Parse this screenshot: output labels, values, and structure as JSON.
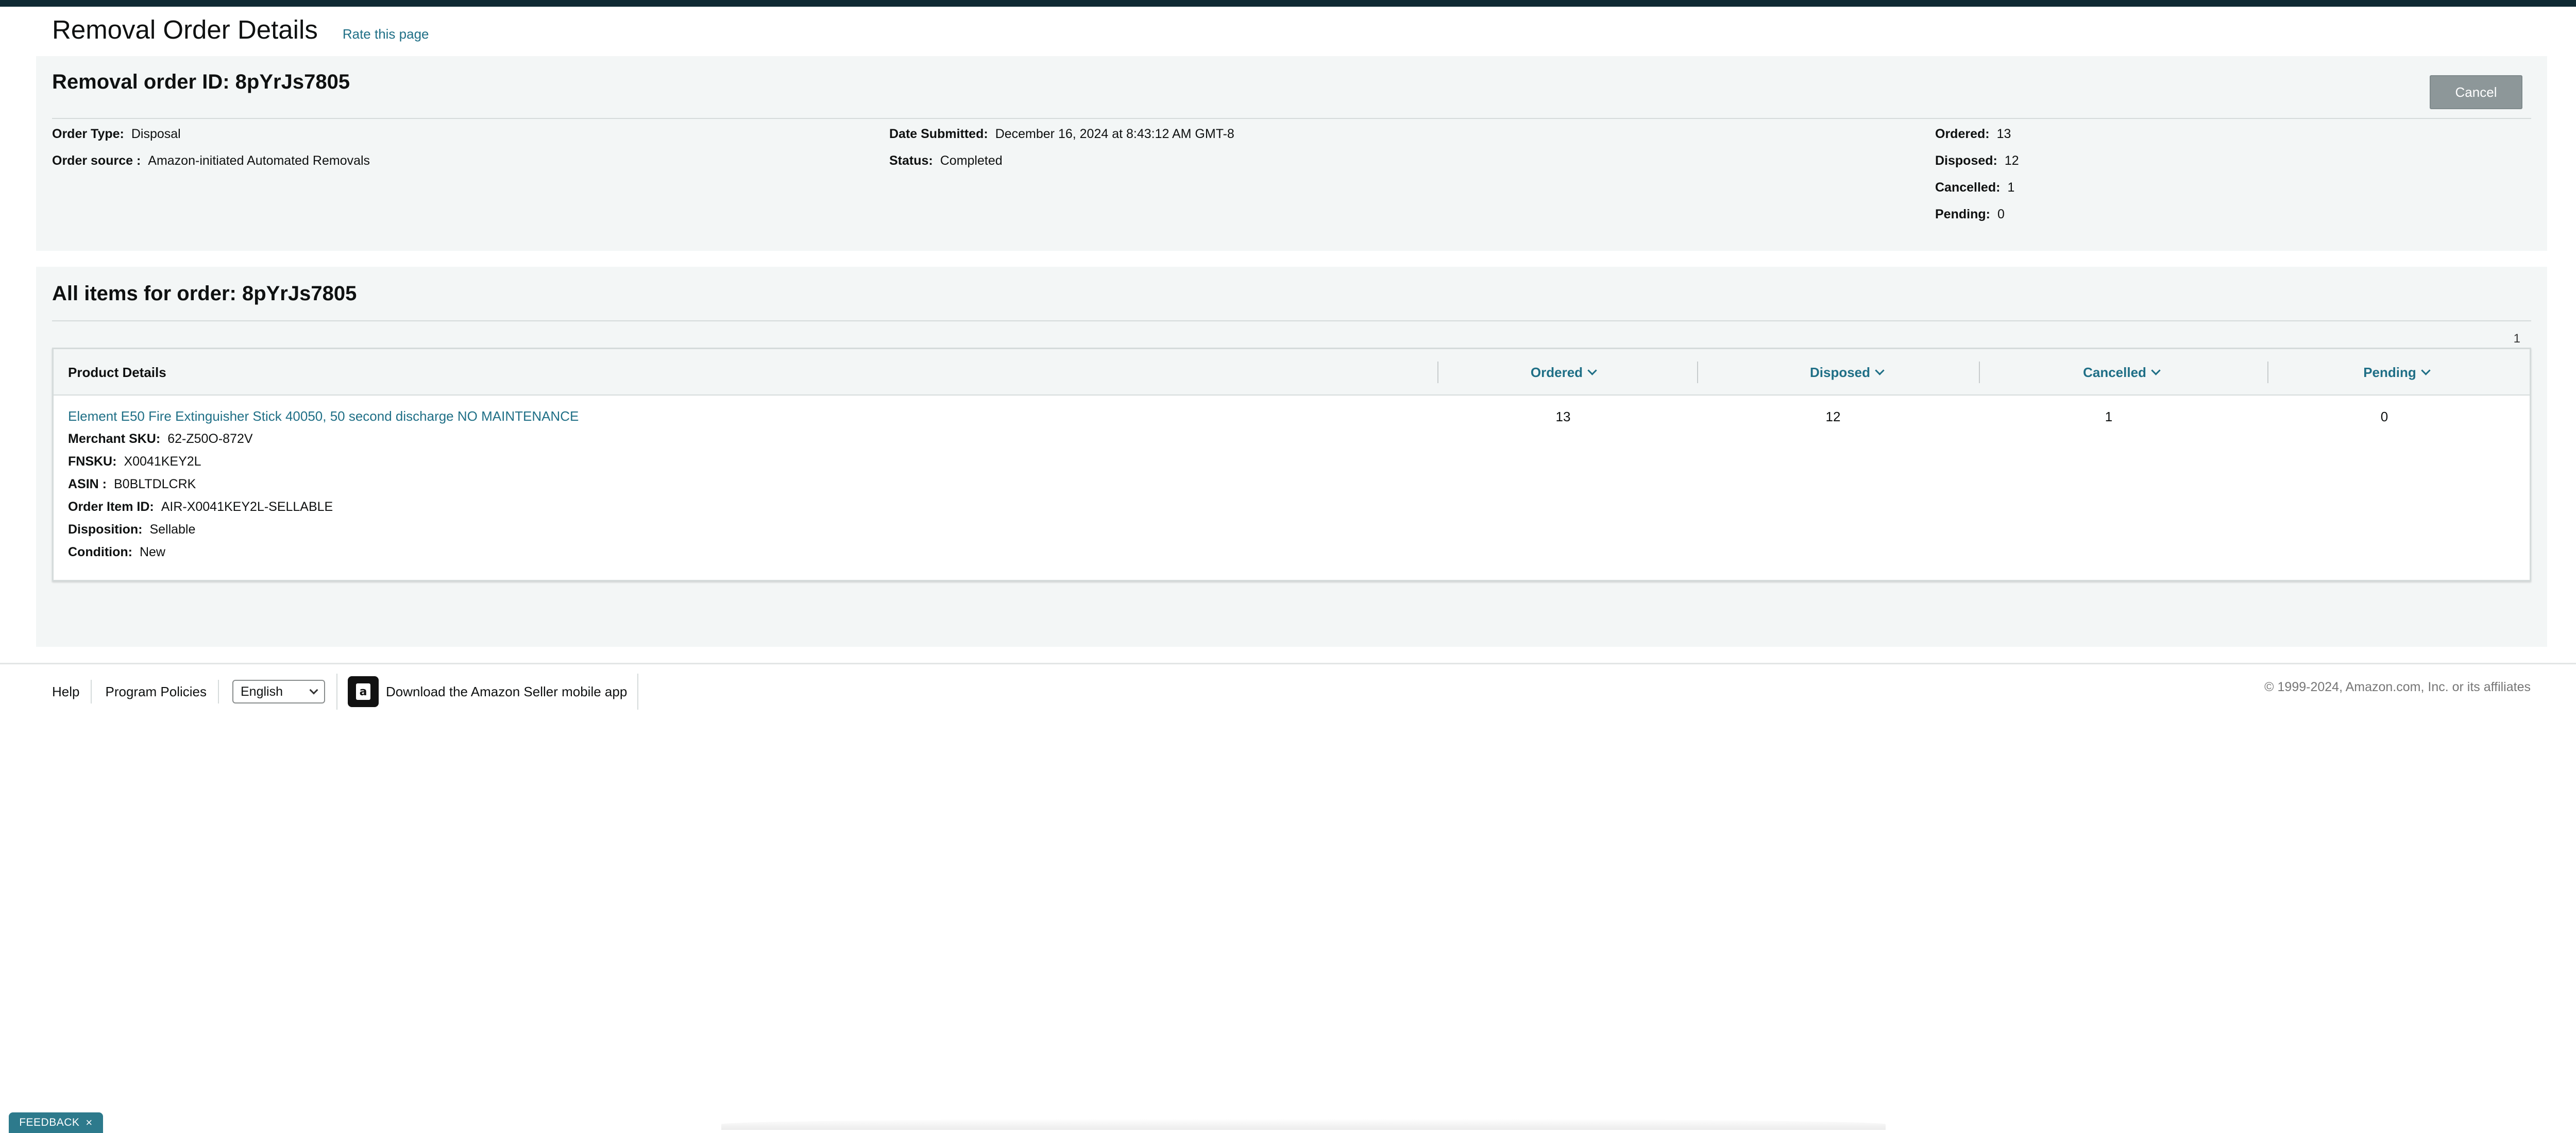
{
  "header": {
    "title": "Removal Order Details",
    "rate_link": "Rate this page"
  },
  "order": {
    "id_label": "Removal order ID:",
    "id": "8pYrJs7805",
    "cancel_label": "Cancel",
    "fields": {
      "order_type": {
        "label": "Order Type:",
        "value": "Disposal"
      },
      "order_source": {
        "label": "Order source :",
        "value": "Amazon-initiated Automated Removals"
      },
      "date_submitted": {
        "label": "Date Submitted:",
        "value": "December 16, 2024 at 8:43:12 AM GMT-8"
      },
      "status": {
        "label": "Status:",
        "value": "Completed"
      },
      "ordered": {
        "label": "Ordered:",
        "value": "13"
      },
      "disposed": {
        "label": "Disposed:",
        "value": "12"
      },
      "cancelled": {
        "label": "Cancelled:",
        "value": "1"
      },
      "pending": {
        "label": "Pending:",
        "value": "0"
      }
    }
  },
  "items": {
    "title": "All items for order: 8pYrJs7805",
    "page_number": "1",
    "columns": {
      "product": "Product Details",
      "ordered": "Ordered",
      "disposed": "Disposed",
      "cancelled": "Cancelled",
      "pending": "Pending"
    },
    "row": {
      "product_title": "Element E50 Fire Extinguisher Stick 40050, 50 second discharge NO MAINTENANCE",
      "details": {
        "merchant_sku": {
          "label": "Merchant SKU:",
          "value": "62-Z50O-872V"
        },
        "fnsku": {
          "label": "FNSKU:",
          "value": "X0041KEY2L"
        },
        "asin": {
          "label": "ASIN :",
          "value": "B0BLTDLCRK"
        },
        "order_item_id": {
          "label": "Order Item ID:",
          "value": "AIR-X0041KEY2L-SELLABLE"
        },
        "disposition": {
          "label": "Disposition:",
          "value": "Sellable"
        },
        "condition": {
          "label": "Condition:",
          "value": "New"
        }
      },
      "ordered": "13",
      "disposed": "12",
      "cancelled": "1",
      "pending": "0"
    }
  },
  "footer": {
    "help": "Help",
    "program_policies": "Program Policies",
    "language": "English",
    "app_link": "Download the Amazon Seller mobile app",
    "app_icon": "amazon-bag-icon",
    "copyright": "© 1999-2024, Amazon.com, Inc. or its affiliates"
  },
  "feedback": {
    "label": "FEEDBACK",
    "close": "×"
  },
  "colors": {
    "link": "#1f6f86",
    "panel_bg": "#f3f6f6",
    "topbar": "#0f2a33",
    "feedback_bg": "#2d7a8c"
  }
}
